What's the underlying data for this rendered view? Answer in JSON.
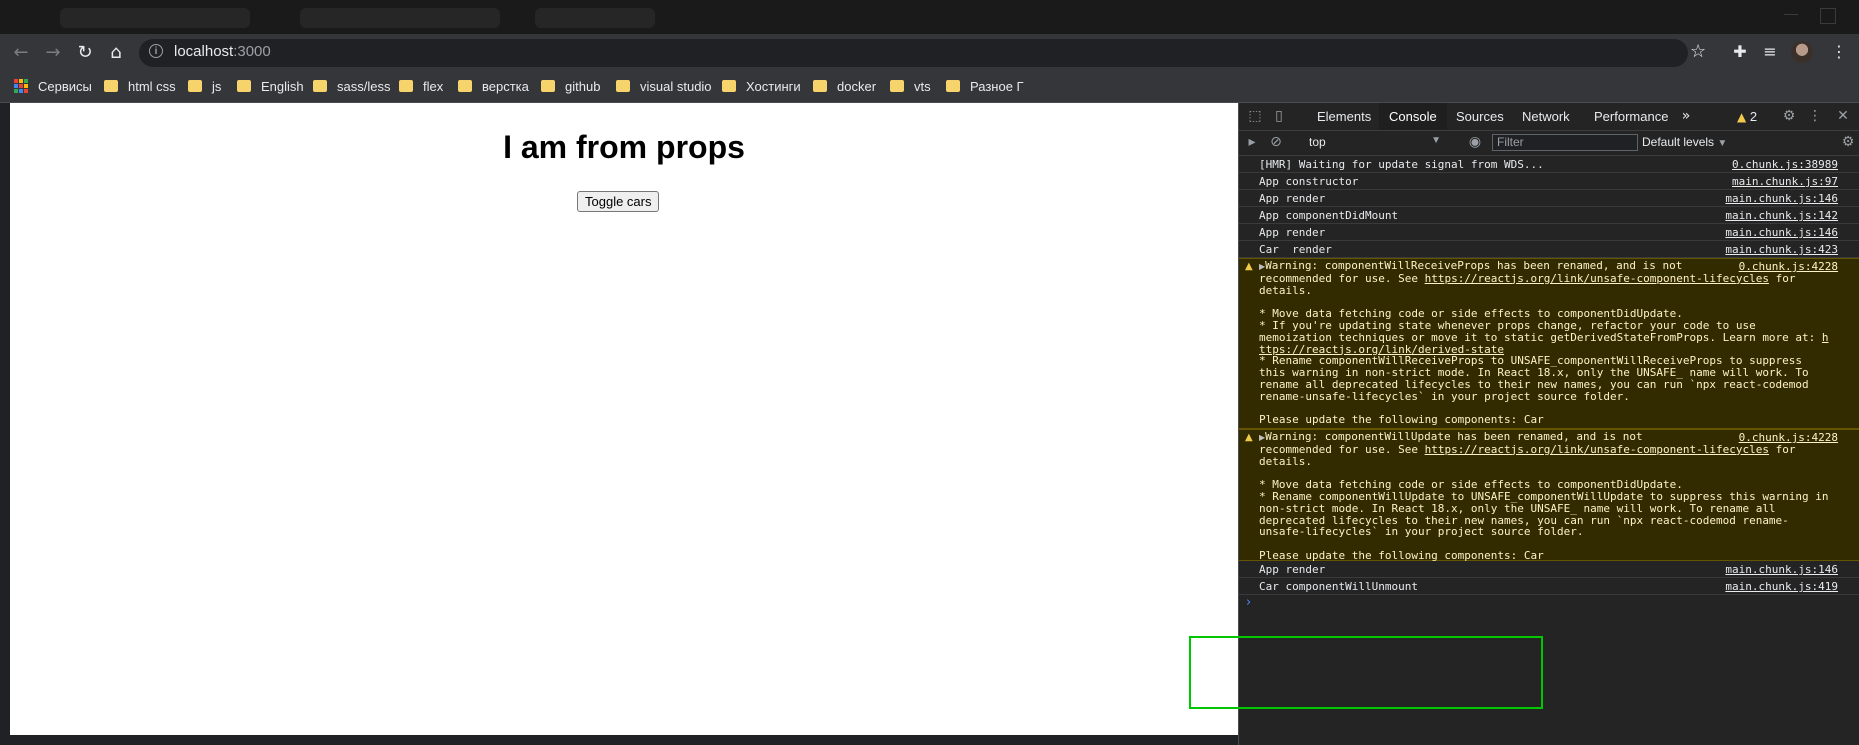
{
  "browser": {
    "url_host": "localhost",
    "url_port": ":3000",
    "bookmarks": [
      {
        "label": "Сервисы",
        "icon": "apps-grid-icon"
      },
      {
        "label": "html css",
        "icon": "folder-icon"
      },
      {
        "label": "js",
        "icon": "folder-icon"
      },
      {
        "label": "English",
        "icon": "folder-icon"
      },
      {
        "label": "sass/less",
        "icon": "folder-icon"
      },
      {
        "label": "flex",
        "icon": "folder-icon"
      },
      {
        "label": "верстка",
        "icon": "folder-icon"
      },
      {
        "label": "github",
        "icon": "folder-icon"
      },
      {
        "label": "visual studio",
        "icon": "folder-icon"
      },
      {
        "label": "Хостинги",
        "icon": "folder-icon"
      },
      {
        "label": "docker",
        "icon": "folder-icon"
      },
      {
        "label": "vts",
        "icon": "folder-icon"
      },
      {
        "label": "Разное Г",
        "icon": "folder-icon"
      }
    ]
  },
  "page": {
    "heading": "I am from props",
    "toggle_button": "Toggle cars"
  },
  "devtools": {
    "tabs": [
      "Elements",
      "Console",
      "Sources",
      "Network",
      "Performance"
    ],
    "active_tab": "Console",
    "more_tabs": "»",
    "warnings_count": "2",
    "context": "top",
    "filter_placeholder": "Filter",
    "levels": "Default levels",
    "logs_top": [
      {
        "msg": "[HMR] Waiting for update signal from WDS...",
        "src": "0.chunk.js:38989"
      },
      {
        "msg": "App constructor",
        "src": "main.chunk.js:97"
      },
      {
        "msg": "App render",
        "src": "main.chunk.js:146"
      },
      {
        "msg": "App componentDidMount",
        "src": "main.chunk.js:142"
      },
      {
        "msg": "App render",
        "src": "main.chunk.js:146"
      },
      {
        "msg": "Car  render",
        "src": "main.chunk.js:423"
      }
    ],
    "warning1": {
      "src": "0.chunk.js:4228",
      "p1": "Warning: componentWillReceiveProps has been renamed, and is not\nrecommended for use. See ",
      "link1": "https://reactjs.org/link/unsafe-component-lifecycles",
      "p2": " for\ndetails.\n\n* Move data fetching code or side effects to componentDidUpdate.\n* If you're updating state whenever props change, refactor your code to use\nmemoization techniques or move it to static getDerivedStateFromProps. Learn more at: ",
      "link2": "h\nttps://reactjs.org/link/derived-state",
      "p3": "\n* Rename componentWillReceiveProps to UNSAFE_componentWillReceiveProps to suppress\nthis warning in non-strict mode. In React 18.x, only the UNSAFE_ name will work. To\nrename all deprecated lifecycles to their new names, you can run `npx react-codemod\nrename-unsafe-lifecycles` in your project source folder.\n\nPlease update the following components: Car"
    },
    "warning2": {
      "src": "0.chunk.js:4228",
      "p1": "Warning: componentWillUpdate has been renamed, and is not\nrecommended for use. See ",
      "link1": "https://reactjs.org/link/unsafe-component-lifecycles",
      "p2": " for\ndetails.\n\n* Move data fetching code or side effects to componentDidUpdate.\n* Rename componentWillUpdate to UNSAFE_componentWillUpdate to suppress this warning in\nnon-strict mode. In React 18.x, only the UNSAFE_ name will work. To rename all\ndeprecated lifecycles to their new names, you can run `npx react-codemod rename-\nunsafe-lifecycles` in your project source folder.\n\nPlease update the following components: Car"
    },
    "logs_bottom": [
      {
        "msg": "App render",
        "src": "main.chunk.js:146"
      },
      {
        "msg": "Car componentWillUnmount",
        "src": "main.chunk.js:419"
      }
    ],
    "prompt": "›"
  },
  "colors": {
    "highlight_box": "#00c800",
    "warning_bg": "#332b00",
    "folder": "#f6d36b"
  }
}
